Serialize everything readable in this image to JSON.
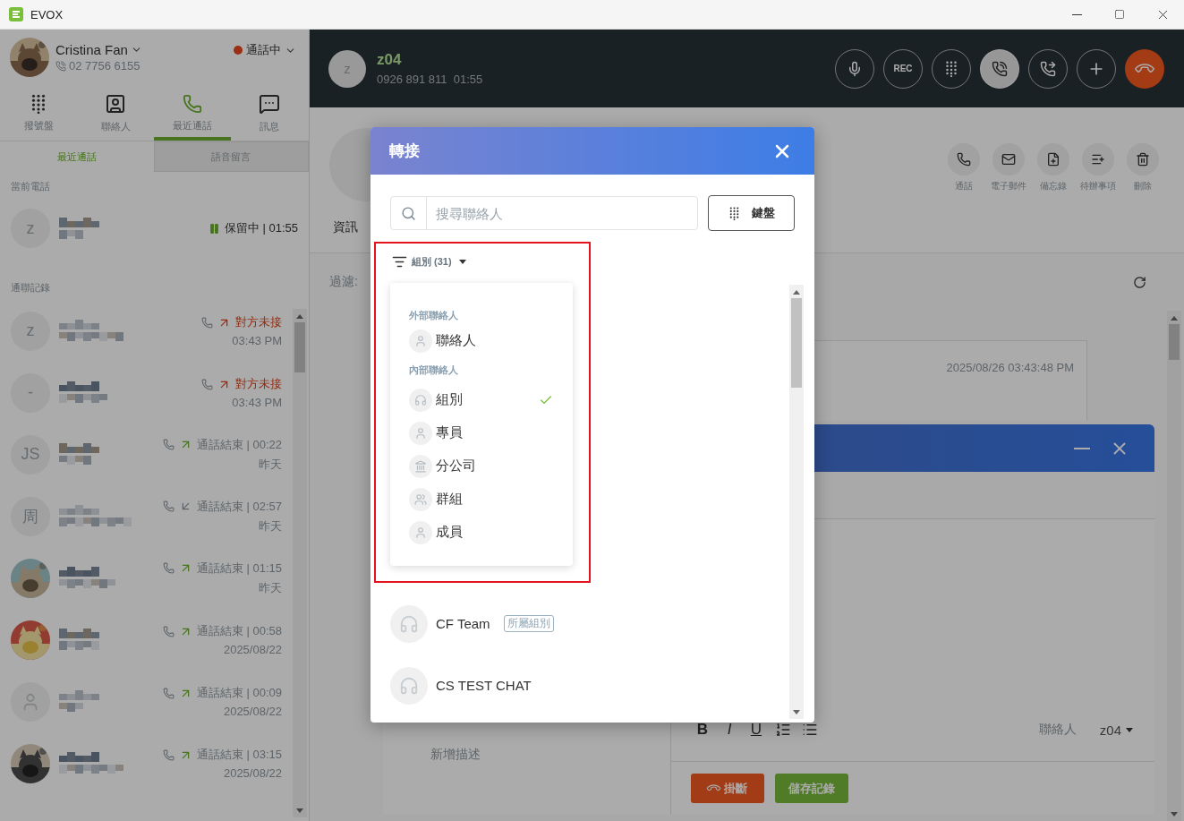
{
  "window": {
    "title": "EVOX"
  },
  "sidebar": {
    "user": {
      "name": "Cristina Fan",
      "phone": "02 7756 6155",
      "status": "通話中"
    },
    "nav": [
      {
        "kind": "dialpad",
        "label": "撥號盤",
        "selected": false
      },
      {
        "kind": "contacts",
        "label": "聯絡人",
        "selected": false
      },
      {
        "kind": "calls",
        "label": "最近通話",
        "selected": true
      },
      {
        "kind": "messages",
        "label": "訊息",
        "selected": false
      }
    ],
    "subtabs": [
      {
        "label": "最近通話",
        "selected": true
      },
      {
        "label": "語音留言",
        "selected": false
      }
    ],
    "current_heading": "當前電話",
    "current_call": {
      "avatar": {
        "kind": "initial",
        "text": "z"
      },
      "on_hold": true,
      "status": "保留中 | 01:55"
    },
    "history_heading": "通聯記錄",
    "history": [
      {
        "avatar": {
          "kind": "initial",
          "text": "z"
        },
        "incoming": false,
        "missed": true,
        "status": "對方未接",
        "time": "03:43 PM"
      },
      {
        "avatar": {
          "kind": "initial",
          "text": "-"
        },
        "incoming": false,
        "missed": true,
        "status": "對方未接",
        "time": "03:43 PM"
      },
      {
        "avatar": {
          "kind": "initial",
          "text": "JS"
        },
        "incoming": false,
        "missed": false,
        "status": "通話結束 | 00:22",
        "time": "昨天"
      },
      {
        "avatar": {
          "kind": "initial",
          "text": "周"
        },
        "incoming": true,
        "missed": false,
        "status": "通話結束 | 02:57",
        "time": "昨天"
      },
      {
        "incoming": false,
        "missed": false,
        "status": "通話結束 | 01:15",
        "time": "昨天"
      },
      {
        "incoming": false,
        "missed": false,
        "status": "通話結束 | 00:58",
        "time": "2025/08/22"
      },
      {
        "avatar": {
          "kind": "person"
        },
        "incoming": false,
        "missed": false,
        "status": "通話結束 | 00:09",
        "time": "2025/08/22"
      },
      {
        "incoming": false,
        "missed": false,
        "status": "通話結束 | 03:15",
        "time": "2025/08/22"
      }
    ]
  },
  "call_bar": {
    "avatar": "z",
    "name": "z04",
    "number": "0926 891 811",
    "duration": "01:55",
    "controls": [
      {
        "kind": "mic",
        "on": false
      },
      {
        "kind": "rec",
        "label": "REC",
        "on": false
      },
      {
        "kind": "dialpad",
        "on": false
      },
      {
        "kind": "hold",
        "on": true
      },
      {
        "kind": "transfer",
        "on": false
      },
      {
        "kind": "add",
        "on": false
      },
      {
        "kind": "hangup"
      }
    ]
  },
  "contact": {
    "tab": "資訊",
    "actions": [
      {
        "kind": "call",
        "label": "通話"
      },
      {
        "kind": "email",
        "label": "電子郵件"
      },
      {
        "kind": "note",
        "label": "備忘錄"
      },
      {
        "kind": "todo",
        "label": "待辦事項"
      },
      {
        "kind": "delete",
        "label": "刪除"
      }
    ]
  },
  "filter": {
    "label": "過濾:"
  },
  "record": {
    "timestamp": "2025/08/26 03:43:48 PM"
  },
  "note_window": {
    "description_placeholder": "新增描述",
    "format_buttons": [
      {
        "kind": "bold",
        "label": "B"
      },
      {
        "kind": "italic",
        "label": "I"
      },
      {
        "kind": "underline",
        "label": "U"
      },
      {
        "kind": "ordered"
      },
      {
        "kind": "bullets"
      }
    ],
    "contact_label": "聯絡人",
    "contact_value": "z04",
    "buttons": [
      {
        "kind": "hangup",
        "label": "掛斷"
      },
      {
        "kind": "save",
        "label": "儲存記錄"
      }
    ]
  },
  "dialog": {
    "title": "轉接",
    "search": {
      "placeholder": "搜尋聯絡人"
    },
    "keypad_button": "鍵盤",
    "filter": "組別 (31)",
    "menu": {
      "sections": [
        {
          "heading": "外部聯絡人",
          "items": [
            {
              "kind": "person",
              "label": "聯絡人",
              "selected": false
            }
          ]
        },
        {
          "heading": "內部聯絡人",
          "items": [
            {
              "kind": "headset",
              "label": "組別",
              "selected": true
            },
            {
              "kind": "person",
              "label": "專員",
              "selected": false
            },
            {
              "kind": "building",
              "label": "分公司",
              "selected": false
            },
            {
              "kind": "people",
              "label": "群組",
              "selected": false
            },
            {
              "kind": "person",
              "label": "成員",
              "selected": false
            }
          ]
        }
      ]
    },
    "results": [
      {
        "name": "CF Team",
        "tag": "所屬組別"
      },
      {
        "name": "CS TEST CHAT"
      }
    ]
  }
}
